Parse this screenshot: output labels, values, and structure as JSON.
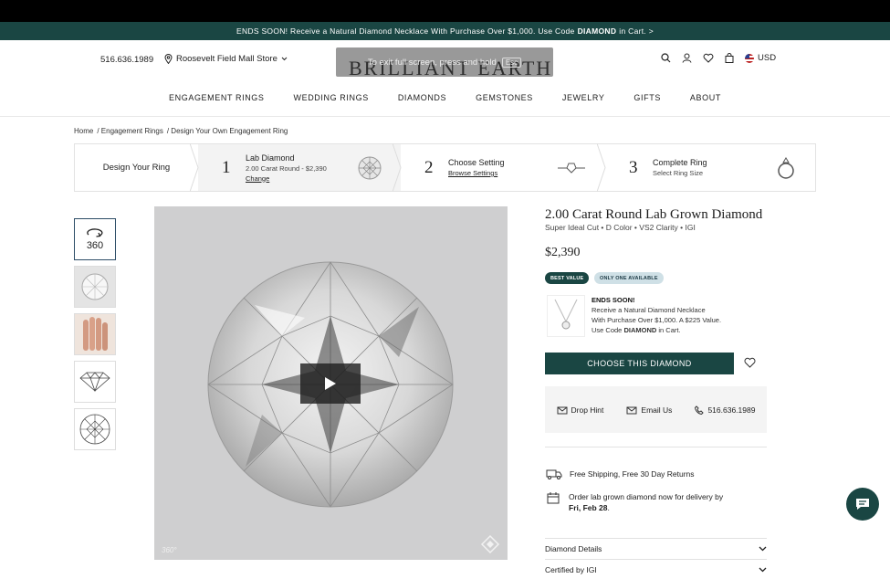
{
  "promo": {
    "text_pre": "ENDS SOON! Receive a Natural Diamond Necklace With Purchase Over $1,000. Use Code",
    "code": "DIAMOND",
    "text_post": "in Cart. >"
  },
  "header": {
    "phone": "516.636.1989",
    "store": "Roosevelt Field Mall Store",
    "logo": "BRILLIANT EARTH",
    "overlay_text": "To exit full screen, press and hold",
    "overlay_key": "Esc",
    "currency": "USD"
  },
  "nav": [
    "ENGAGEMENT RINGS",
    "WEDDING RINGS",
    "DIAMONDS",
    "GEMSTONES",
    "JEWELRY",
    "GIFTS",
    "ABOUT"
  ],
  "breadcrumbs": [
    "Home",
    "/ Engagement Rings",
    "/ Design Your Own Engagement Ring"
  ],
  "steps": {
    "intro": "Design Your Ring",
    "s1": {
      "num": "1",
      "title": "Lab Diamond",
      "sub": "2.00 Carat Round - $2,390",
      "link": "Change"
    },
    "s2": {
      "num": "2",
      "title": "Choose Setting",
      "link": "Browse Settings"
    },
    "s3": {
      "num": "3",
      "title": "Complete Ring",
      "sub": "Select Ring Size"
    }
  },
  "thumbs": {
    "t360": "360"
  },
  "media": {
    "badge": "360°"
  },
  "product": {
    "title": "2.00 Carat Round Lab Grown Diamond",
    "subtitle": "Super Ideal Cut • D Color • VS2 Clarity • IGI",
    "price": "$2,390",
    "badge_best": "BEST VALUE",
    "badge_only": "ONLY ONE AVAILABLE",
    "offer": {
      "heading": "ENDS SOON!",
      "line1": "Receive a Natural Diamond Necklace",
      "line2": "With Purchase Over $1,000. A $225 Value.",
      "line3_pre": "Use Code",
      "line3_code": "DIAMOND",
      "line3_post": "in Cart."
    },
    "cta": "CHOOSE THIS DIAMOND",
    "actions": {
      "hint": "Drop Hint",
      "email": "Email Us",
      "phone": "516.636.1989"
    },
    "shipping": "Free Shipping, Free 30 Day Returns",
    "delivery_line1": "Order lab grown diamond now for delivery by",
    "delivery_date": "Fri, Feb 28",
    "accordion": [
      "Diamond Details",
      "Certified by IGI"
    ]
  }
}
